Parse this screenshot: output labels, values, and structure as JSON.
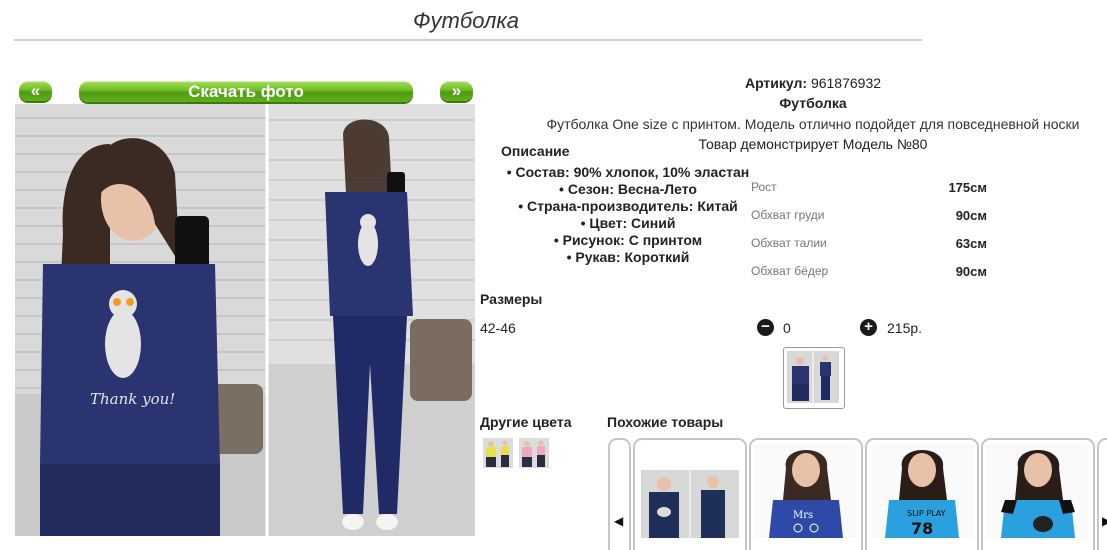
{
  "page": {
    "title": "Футболка"
  },
  "gallery": {
    "prev_label": "«",
    "next_label": "»",
    "download_label": "Скачать фото"
  },
  "product": {
    "sku_label": "Артикул:",
    "sku_value": "961876932",
    "name": "Футболка",
    "description": "Футболка One size с принтом. Модель отлично подойдет для повседневной носки",
    "model_line": "Товар демонстрирует Модель №80",
    "description_heading": "Описание",
    "properties": [
      "Состав: 90% хлопок, 10% эластан",
      "Сезон: Весна-Лето",
      "Страна-производитель: Китай",
      "Цвет: Синий",
      "Рисунок: С принтом",
      "Рукав: Короткий"
    ]
  },
  "measurements": [
    {
      "label": "Рост",
      "value": "175см"
    },
    {
      "label": "Обхват груди",
      "value": "90см"
    },
    {
      "label": "Обхват талии",
      "value": "63см"
    },
    {
      "label": "Обхват бёдер",
      "value": "90см"
    }
  ],
  "sizes": {
    "heading": "Размеры",
    "range": "42-46",
    "quantity": "0",
    "minus_icon": "minus-circle-icon",
    "plus_icon": "plus-circle-icon",
    "price": "215р."
  },
  "other_colors": {
    "heading": "Другие цвета"
  },
  "similar": {
    "heading": "Похожие товары"
  },
  "colors": {
    "accent_green": "#6cbc22",
    "shirt_navy": "#2a3470",
    "shirt_sky": "#2aa0de"
  }
}
